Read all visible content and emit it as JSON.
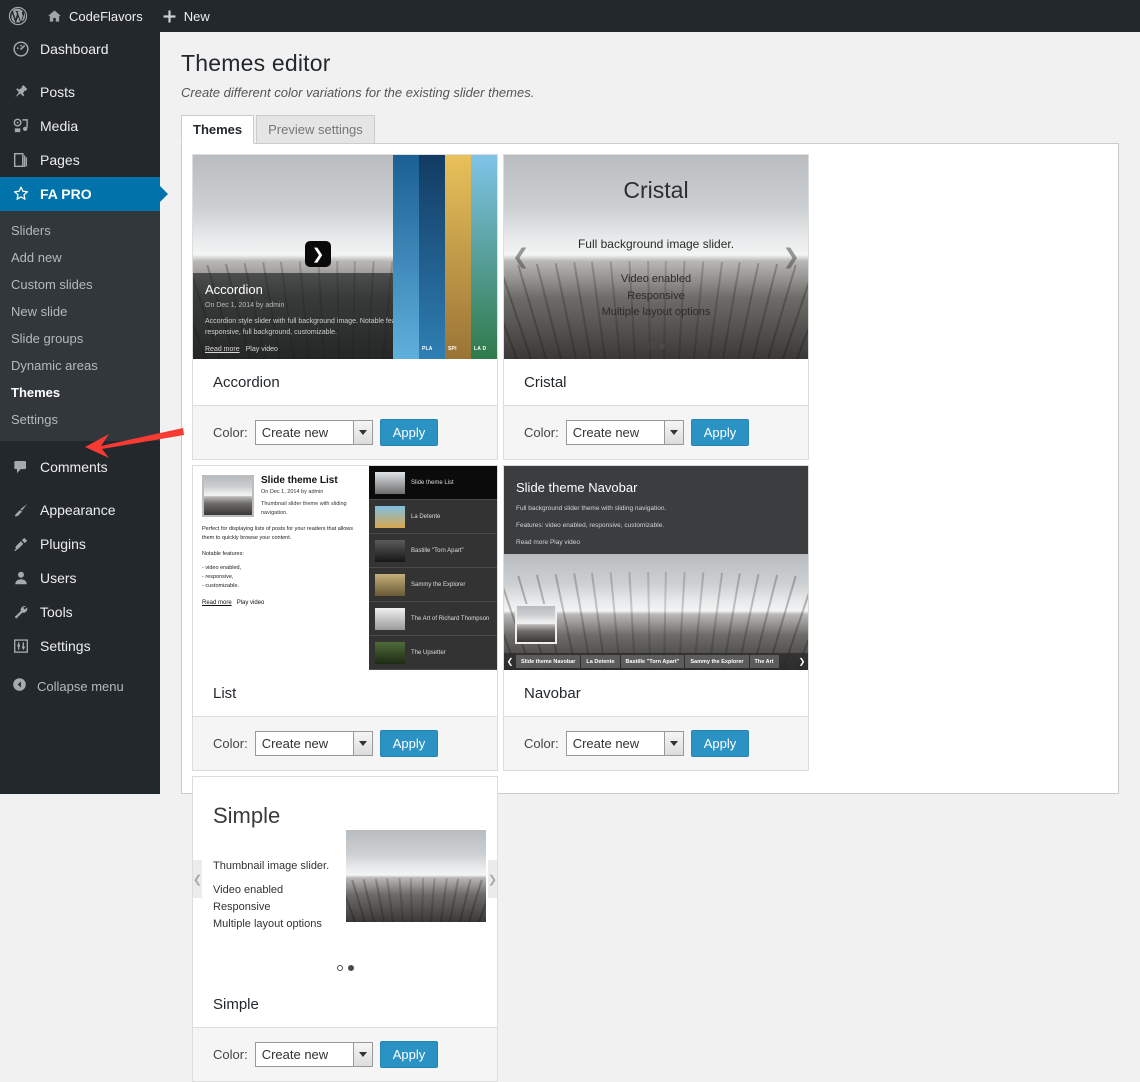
{
  "adminbar": {
    "logo_icon": "wordpress-logo-icon",
    "site_icon": "home-icon",
    "site_name": "CodeFlavors",
    "new_icon": "plus-icon",
    "new_label": "New"
  },
  "sidebar": {
    "items": [
      {
        "label": "Dashboard",
        "icon": "dashboard-icon",
        "key": "dashboard"
      },
      {
        "label": "Posts",
        "icon": "pin-icon",
        "key": "posts"
      },
      {
        "label": "Media",
        "icon": "media-icon",
        "key": "media"
      },
      {
        "label": "Pages",
        "icon": "pages-icon",
        "key": "pages"
      },
      {
        "label": "FA PRO",
        "icon": "star-icon",
        "key": "fa-pro",
        "current": true
      },
      {
        "label": "Comments",
        "icon": "comment-icon",
        "key": "comments"
      },
      {
        "label": "Appearance",
        "icon": "brush-icon",
        "key": "appearance"
      },
      {
        "label": "Plugins",
        "icon": "plug-icon",
        "key": "plugins"
      },
      {
        "label": "Users",
        "icon": "user-icon",
        "key": "users"
      },
      {
        "label": "Tools",
        "icon": "wrench-icon",
        "key": "tools"
      },
      {
        "label": "Settings",
        "icon": "sliders-icon",
        "key": "settings"
      }
    ],
    "submenu": [
      {
        "label": "Sliders"
      },
      {
        "label": "Add new"
      },
      {
        "label": "Custom slides"
      },
      {
        "label": "New slide"
      },
      {
        "label": "Slide groups"
      },
      {
        "label": "Dynamic areas"
      },
      {
        "label": "Themes",
        "current": true
      },
      {
        "label": "Settings"
      }
    ],
    "collapse_label": "Collapse menu",
    "collapse_icon": "collapse-arrow-icon",
    "annotation": {
      "icon": "red-arrow-icon",
      "color": "#f73b32",
      "points_at": "Themes"
    }
  },
  "page": {
    "title": "Themes editor",
    "subtitle": "Create different color variations for the existing slider themes."
  },
  "tabs": [
    {
      "label": "Themes",
      "active": true
    },
    {
      "label": "Preview settings",
      "active": false
    }
  ],
  "controls": {
    "color_label": "Color:",
    "select_value": "Create new",
    "apply_label": "Apply",
    "apply_color": "#2b93c4",
    "dropdown_icon": "chevron-down-icon"
  },
  "themes": [
    {
      "name": "Accordion",
      "preview": {
        "kind": "accordion",
        "overlay_title": "Accordion",
        "overlay_meta": "On Dec 1, 2014 by admin",
        "overlay_desc": "Accordion style slider with full background image. Notable features: video enabled, responsive, full background, customizable.",
        "read_more": "Read more",
        "play_video": "Play video",
        "nav_icon": "chevron-right-icon",
        "panels": [
          {
            "label": "",
            "c1": "#1b5f93",
            "c2": "#5fb0dd"
          },
          {
            "label": "PLA",
            "c1": "#123b63",
            "c2": "#2f7fb4"
          },
          {
            "label": "SPI",
            "c1": "#e8c15a",
            "c2": "#9a7436"
          },
          {
            "label": "LA D",
            "c1": "#7fc4e8",
            "c2": "#2f7a4a"
          }
        ]
      }
    },
    {
      "name": "Cristal",
      "preview": {
        "kind": "cristal",
        "title": "Cristal",
        "line1": "Full background image slider.",
        "lines": "Video enabled\nResponsive\nMultiple layout options",
        "prev_icon": "chevron-left-icon",
        "next_icon": "chevron-right-icon",
        "dots": 2,
        "active_dot": 2
      }
    },
    {
      "name": "List",
      "preview": {
        "kind": "list",
        "heading": "Slide theme List",
        "meta": "On Dec 1, 2014 by admin",
        "sub": "Thumbnail slider theme with sliding navigation.",
        "paragraph": "Perfect for displaying lists of posts for your readers that allows them to quickly browse your content.",
        "features_label": "Notable features:",
        "features": [
          "- video enabled,",
          "- responsive,",
          "- customizable."
        ],
        "read_more": "Read more",
        "play_video": "Play video",
        "items": [
          {
            "label": "Slide theme List",
            "c1": "#dfe3e6",
            "c2": "#6d6d6d"
          },
          {
            "label": "La Detente",
            "c1": "#7fc0e2",
            "c2": "#d7a64e"
          },
          {
            "label": "Bastille \"Torn Apart\"",
            "c1": "#5b5b5b",
            "c2": "#161616"
          },
          {
            "label": "Sammy the Explorer",
            "c1": "#c5b07a",
            "c2": "#6a5a35"
          },
          {
            "label": "The Art of Richard Thompson",
            "c1": "#f0f0f0",
            "c2": "#9a9a9a"
          },
          {
            "label": "The Upsetter",
            "c1": "#4e6b3a",
            "c2": "#1d2a14"
          }
        ]
      }
    },
    {
      "name": "Navobar",
      "preview": {
        "kind": "navobar",
        "heading": "Slide theme Navobar",
        "line1": "Full background slider theme with sliding navigation.",
        "line2": "Features: video enabled, responsive, customizable.",
        "line3": "Read more Play video",
        "prev_icon": "chevron-left-icon",
        "next_icon": "chevron-right-icon",
        "nav_items": [
          "Slide theme Navobar",
          "La Detente",
          "Bastille \"Torn Apart\"",
          "Sammy the Explorer",
          "The Art"
        ]
      }
    },
    {
      "name": "Simple",
      "preview": {
        "kind": "simple",
        "title": "Simple",
        "line1": "Thumbnail image slider.",
        "lines": "Video enabled\nResponsive\nMultiple layout options",
        "prev_icon": "chevron-left-icon",
        "next_icon": "chevron-right-icon",
        "dots": 2,
        "active_dot": 2
      }
    }
  ]
}
